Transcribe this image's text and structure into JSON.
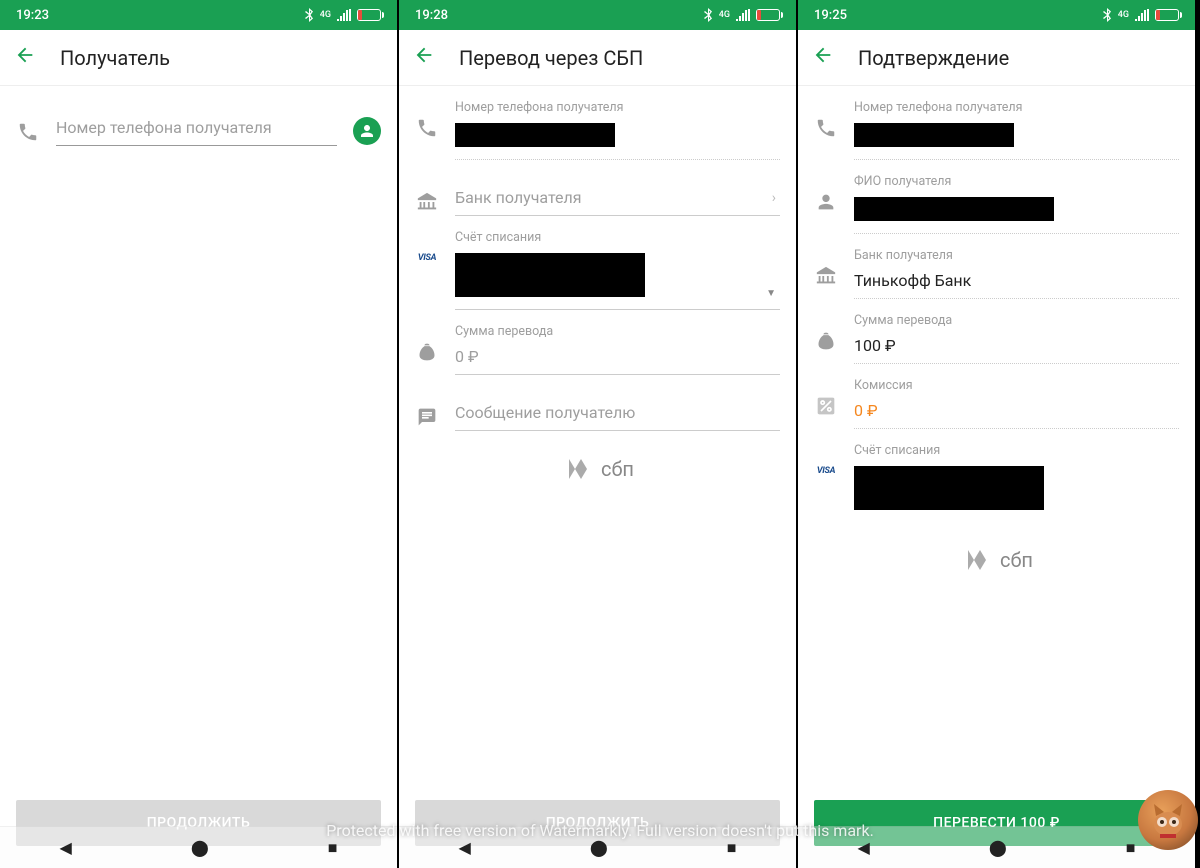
{
  "screens": [
    {
      "status_time": "19:23",
      "title": "Получатель",
      "phone_placeholder": "Номер телефона получателя",
      "button": "ПРОДОЛЖИТЬ"
    },
    {
      "status_time": "19:28",
      "title": "Перевод через СБП",
      "phone_label": "Номер телефона получателя",
      "bank_placeholder": "Банк получателя",
      "account_label": "Счёт списания",
      "amount_label": "Сумма перевода",
      "amount_value": "0 ₽",
      "message_placeholder": "Сообщение получателю",
      "sbp_label": "сбп",
      "button": "ПРОДОЛЖИТЬ"
    },
    {
      "status_time": "19:25",
      "title": "Подтверждение",
      "phone_label": "Номер телефона получателя",
      "name_label": "ФИО получателя",
      "bank_label": "Банк получателя",
      "bank_value": "Тинькофф Банк",
      "amount_label": "Сумма перевода",
      "amount_value": "100 ₽",
      "fee_label": "Комиссия",
      "fee_value": "0 ₽",
      "account_label": "Счёт списания",
      "sbp_label": "сбп",
      "button": "ПЕРЕВЕСТИ 100 ₽"
    }
  ],
  "network_label": "4G",
  "watermark": "Protected with free version of Watermarkly. Full version doesn't put this mark."
}
